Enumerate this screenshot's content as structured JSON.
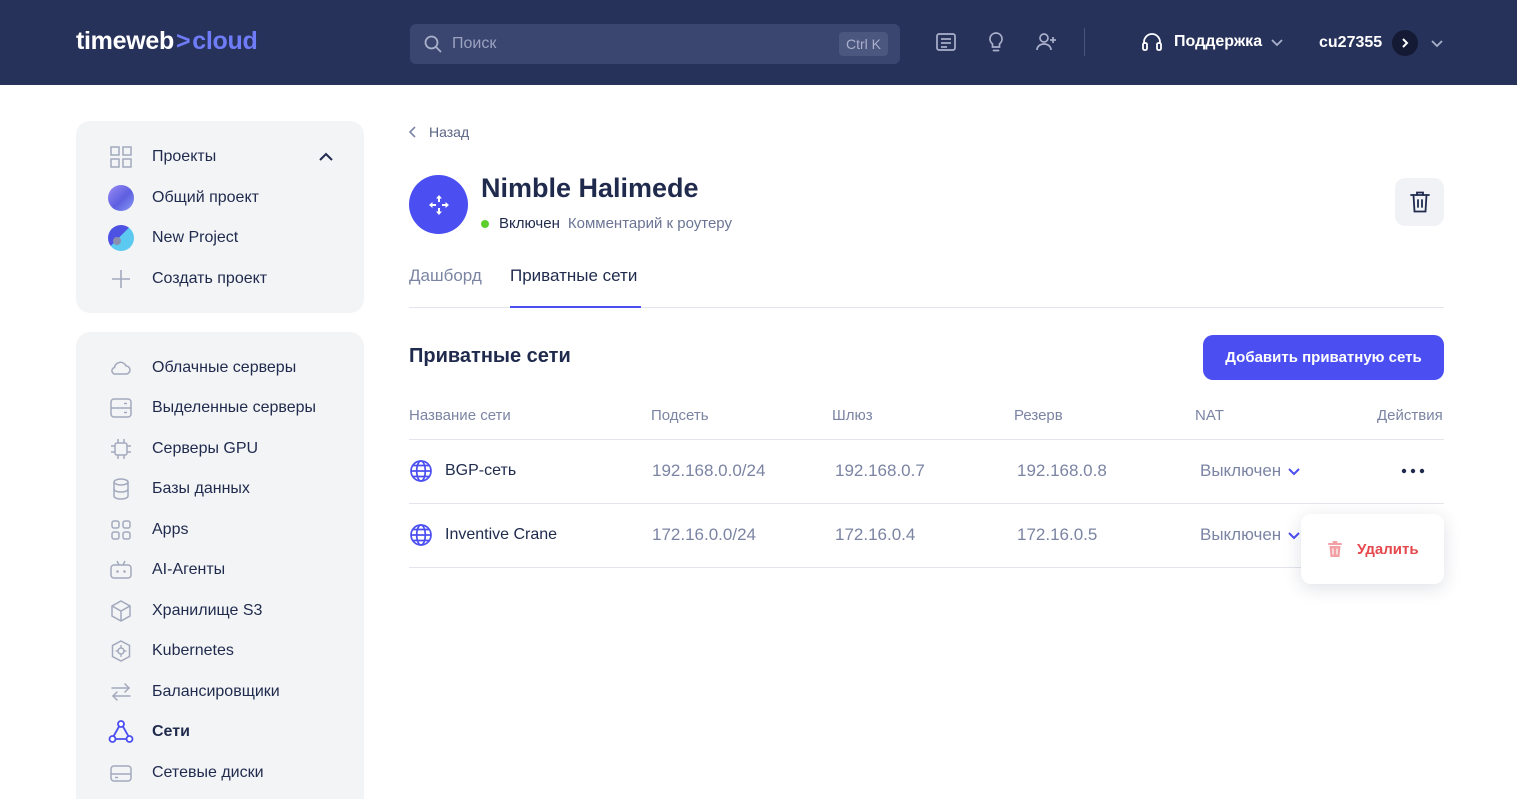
{
  "header": {
    "logo_left": "timeweb",
    "logo_sep": ">",
    "logo_right": "cloud",
    "search_placeholder": "Поиск",
    "search_shortcut": "Ctrl K",
    "support_label": "Поддержка",
    "user_label": "cu27355"
  },
  "sidebar": {
    "projects": {
      "title": "Проекты",
      "items": [
        {
          "label": "Общий проект"
        },
        {
          "label": "New Project"
        },
        {
          "label": "Создать проект"
        }
      ]
    },
    "services": [
      {
        "label": "Облачные серверы",
        "icon": "cloud-icon"
      },
      {
        "label": "Выделенные серверы",
        "icon": "server-icon"
      },
      {
        "label": "Серверы GPU",
        "icon": "chip-icon"
      },
      {
        "label": "Базы данных",
        "icon": "database-icon"
      },
      {
        "label": "Apps",
        "icon": "apps-icon"
      },
      {
        "label": "AI-Агенты",
        "icon": "robot-icon"
      },
      {
        "label": "Хранилище S3",
        "icon": "cube-icon"
      },
      {
        "label": "Kubernetes",
        "icon": "kubernetes-icon"
      },
      {
        "label": "Балансировщики",
        "icon": "balancer-icon"
      },
      {
        "label": "Сети",
        "icon": "network-icon",
        "active": true
      },
      {
        "label": "Сетевые диски",
        "icon": "disk-icon"
      }
    ]
  },
  "main": {
    "back_label": "Назад",
    "router_title": "Nimble Halimede",
    "status_label": "Включен",
    "comment_label": "Комментарий к роутеру",
    "tabs": [
      {
        "label": "Дашборд"
      },
      {
        "label": "Приватные сети",
        "active": true
      }
    ],
    "section_title": "Приватные сети",
    "add_button": "Добавить приватную сеть",
    "table": {
      "headers": [
        "Название сети",
        "Подсеть",
        "Шлюз",
        "Резерв",
        "NAT",
        "Действия"
      ],
      "rows": [
        {
          "name": "BGP-сеть",
          "subnet": "192.168.0.0/24",
          "gateway": "192.168.0.7",
          "reserve": "192.168.0.8",
          "nat": "Выключен"
        },
        {
          "name": "Inventive Crane",
          "subnet": "172.16.0.0/24",
          "gateway": "172.16.0.4",
          "reserve": "172.16.0.5",
          "nat": "Выключен"
        }
      ]
    },
    "actions_menu": {
      "delete_label": "Удалить"
    }
  },
  "colors": {
    "header_bg": "#27325a",
    "accent": "#4b4ef0",
    "danger": "#e5484d",
    "status_on": "#5ccf2b"
  }
}
